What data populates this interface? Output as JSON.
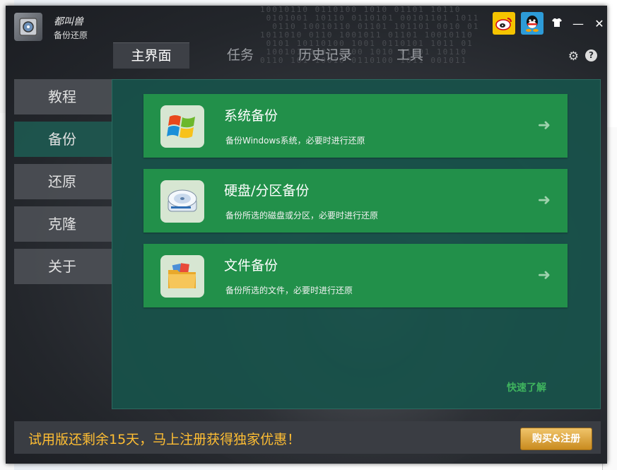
{
  "app": {
    "brand_cn": "都叫兽",
    "brand_sub": "备份还原",
    "logo_icon": "safe-icon"
  },
  "titlebar": {
    "weibo_icon": "weibo-icon",
    "qq_icon": "qq-icon",
    "skin_icon": "tshirt-icon",
    "minimize": "—",
    "close": "✕"
  },
  "tabs": [
    {
      "label": "主界面",
      "active": true
    },
    {
      "label": "任务"
    },
    {
      "label": "历史记录"
    },
    {
      "label": "工具"
    }
  ],
  "toolbar": {
    "settings_icon": "gear-icon",
    "help_glyph": "?"
  },
  "sidebar": {
    "items": [
      {
        "label": "教程"
      },
      {
        "label": "备份",
        "active": true
      },
      {
        "label": "还原"
      },
      {
        "label": "克隆"
      },
      {
        "label": "关于"
      }
    ]
  },
  "cards": [
    {
      "title": "系统备份",
      "desc": "备份Windows系统，必要时进行还原",
      "icon": "windows-logo-icon"
    },
    {
      "title": "硬盘/分区备份",
      "desc": "备份所选的磁盘或分区，必要时进行还原",
      "icon": "hard-disk-icon"
    },
    {
      "title": "文件备份",
      "desc": "备份所选的文件，必要时进行还原",
      "icon": "folder-icon"
    }
  ],
  "quick_learn": "快速了解",
  "footer": {
    "trial_text": "试用版还剩余15天，马上注册获得独家优惠！",
    "buy_label": "购买&注册"
  },
  "colors": {
    "card_green": "#22904a",
    "content_teal": "#18524a",
    "trial_orange": "#ffbe33",
    "window_dark": "#23262b"
  }
}
